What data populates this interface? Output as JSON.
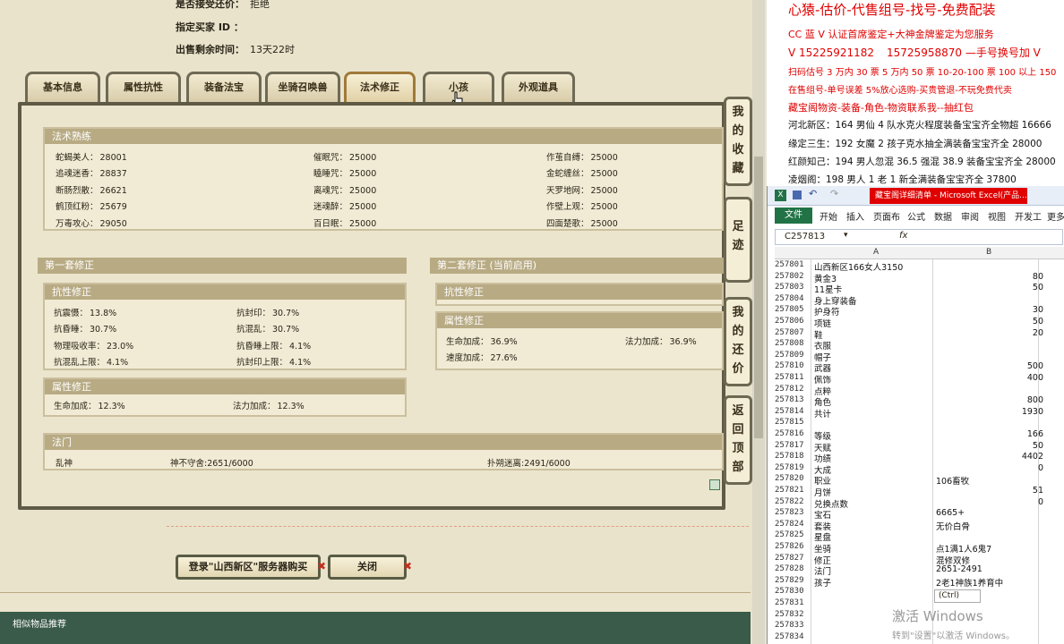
{
  "listing": {
    "counter_offer_label": "是否接受还价：",
    "counter_offer_value": "拒绝",
    "buyer_id_label": "指定买家 ID ：",
    "remaining_label": "出售剩余时间：",
    "remaining_value": "13天22时"
  },
  "tabs": [
    "基本信息",
    "属性抗性",
    "装备法宝",
    "坐骑召唤兽",
    "法术修正",
    "小孩",
    "外观道具"
  ],
  "skill_mastery": {
    "title": "法术熟练",
    "items": [
      {
        "name": "蛇蝎美人：",
        "value": "28001"
      },
      {
        "name": "催眠咒：",
        "value": "25000"
      },
      {
        "name": "作茧自缚：",
        "value": "25000"
      },
      {
        "name": "追魂迷香：",
        "value": "28837"
      },
      {
        "name": "瞌睡咒：",
        "value": "25000"
      },
      {
        "name": "金蛇缠丝：",
        "value": "25000"
      },
      {
        "name": "断肠烈散：",
        "value": "26621"
      },
      {
        "name": "离魂咒：",
        "value": "25000"
      },
      {
        "name": "天罗地网：",
        "value": "25000"
      },
      {
        "name": "鹤顶红粉：",
        "value": "25679"
      },
      {
        "name": "迷魂醉：",
        "value": "25000"
      },
      {
        "name": "作壁上观：",
        "value": "25000"
      },
      {
        "name": "万毒攻心：",
        "value": "29050"
      },
      {
        "name": "百日眠：",
        "value": "25000"
      },
      {
        "name": "四面楚歌：",
        "value": "25000"
      }
    ]
  },
  "set1": {
    "title": "第一套修正",
    "resist_title": "抗性修正",
    "resist_items": [
      {
        "name": "抗震慑：",
        "value": "13.8%"
      },
      {
        "name": "抗封印：",
        "value": "30.7%"
      },
      {
        "name": "抗昏睡：",
        "value": "30.7%"
      },
      {
        "name": "抗混乱：",
        "value": "30.7%"
      },
      {
        "name": "物理吸收率：",
        "value": "23.0%"
      },
      {
        "name": "抗昏睡上限：",
        "value": "4.1%"
      },
      {
        "name": "抗混乱上限：",
        "value": "4.1%"
      },
      {
        "name": "抗封印上限：",
        "value": "4.1%"
      }
    ],
    "attr_title": "属性修正",
    "attr_items": [
      {
        "name": "生命加成：",
        "value": "12.3%"
      },
      {
        "name": "法力加成：",
        "value": "12.3%"
      }
    ]
  },
  "set2": {
    "title": "第二套修正 (当前启用)",
    "resist_title": "抗性修正",
    "attr_title": "属性修正",
    "attr_items": [
      {
        "name": "生命加成：",
        "value": "36.9%"
      },
      {
        "name": "法力加成：",
        "value": "36.9%"
      },
      {
        "name": "速度加成：",
        "value": "27.6%"
      }
    ]
  },
  "faction": {
    "title": "法门",
    "items": [
      "乱神",
      "神不守舍:2651/6000",
      "扑朔迷离:2491/6000"
    ]
  },
  "side_nav": [
    "我的收藏",
    "足迹",
    "我的还价",
    "返回顶部"
  ],
  "buttons": {
    "buy": "登录\"山西新区\"服务器购买",
    "close": "关闭"
  },
  "footer": {
    "similar": "相似物品推荐"
  },
  "promo": {
    "line1": "心猿-估价-代售组号-找号-免费配装",
    "line2": "CC 蓝 V 认证首席鉴定+大神金牌鉴定为您服务",
    "line3a": "V 15225921182",
    "line3b": "15725958870  —手号换号加 V",
    "line4": "扫码估号 3 万内 30 票  5 万内 50 票  10-20-100 票  100 以上 150",
    "line5": "在售组号-单号误差 5%放心选购-买贵管退-不玩免费代卖",
    "line6": "藏宝阁物资-装备-角色-物资联系我--抽红包",
    "line7": "河北新区：164 男仙 4 队水克火程度装备宝宝齐全物超 16666",
    "line8": "缘定三生：192 女魔 2 孩子克水抽全满装备宝宝齐全 28000",
    "line9": "红颜知己：194 男人忽混 36.5 强混 38.9 装备宝宝齐全 28000",
    "line10": "凌烟阁：198 男人 1 老 1 新全满装备宝宝齐全 37800"
  },
  "excel": {
    "title": "藏宝阁详细清单 - Microsoft Excel(产品...",
    "ribbon_tabs": [
      "文件",
      "开始",
      "插入",
      "页面布",
      "公式",
      "数据",
      "审阅",
      "视图",
      "开发工",
      "更多"
    ],
    "name_box": "C257813",
    "fx": "fx",
    "col_a": "A",
    "col_b": "B",
    "rows": [
      {
        "n": "257801",
        "a": "山西新区166女人3150",
        "b": ""
      },
      {
        "n": "257802",
        "a": "黄金3",
        "b": "80"
      },
      {
        "n": "257803",
        "a": "11星卡",
        "b": "50"
      },
      {
        "n": "257804",
        "a": "身上穿装备",
        "b": ""
      },
      {
        "n": "257805",
        "a": "护身符",
        "b": "30"
      },
      {
        "n": "257806",
        "a": "项链",
        "b": "50"
      },
      {
        "n": "257807",
        "a": "鞋",
        "b": "20"
      },
      {
        "n": "257808",
        "a": "衣服",
        "b": ""
      },
      {
        "n": "257809",
        "a": "帽子",
        "b": ""
      },
      {
        "n": "257810",
        "a": "武器",
        "b": "500"
      },
      {
        "n": "257811",
        "a": "佩饰",
        "b": "400"
      },
      {
        "n": "257812",
        "a": "点粹",
        "b": ""
      },
      {
        "n": "257813",
        "a": "角色",
        "b": "800"
      },
      {
        "n": "257814",
        "a": "共计",
        "b": "1930"
      },
      {
        "n": "257815",
        "a": "",
        "b": ""
      },
      {
        "n": "257816",
        "a": "等级",
        "b": "166"
      },
      {
        "n": "257817",
        "a": "天赋",
        "b": "50"
      },
      {
        "n": "257818",
        "a": "功绩",
        "b": "4402"
      },
      {
        "n": "257819",
        "a": "大成",
        "b": "0"
      },
      {
        "n": "257820",
        "a": "职业",
        "b": "106畜牧"
      },
      {
        "n": "257821",
        "a": "月饼",
        "b": "51"
      },
      {
        "n": "257822",
        "a": "兑换点数",
        "b": "0"
      },
      {
        "n": "257823",
        "a": "宝石",
        "b": "6665+"
      },
      {
        "n": "257824",
        "a": "套装",
        "b": "无价白骨"
      },
      {
        "n": "257825",
        "a": "星盘",
        "b": ""
      },
      {
        "n": "257826",
        "a": "坐骑",
        "b": "点1满1人6鬼7"
      },
      {
        "n": "257827",
        "a": "修正",
        "b": "混修双修"
      },
      {
        "n": "257828",
        "a": "法门",
        "b": "2651-2491"
      },
      {
        "n": "257829",
        "a": "孩子",
        "b": "2老1神族1养育中"
      },
      {
        "n": "257830",
        "a": "",
        "b": ""
      },
      {
        "n": "257831",
        "a": "",
        "b": ""
      },
      {
        "n": "257832",
        "a": "",
        "b": ""
      },
      {
        "n": "257833",
        "a": "",
        "b": ""
      },
      {
        "n": "257834",
        "a": "",
        "b": ""
      }
    ],
    "paste_tag": "(Ctrl)"
  },
  "watermark": {
    "line1": "激活 Windows",
    "line2": "转到\"设置\"以激活 Windows。"
  },
  "colors": {
    "accent_red": "#e00000",
    "excel_green": "#217346",
    "title_red": "#e00000"
  }
}
